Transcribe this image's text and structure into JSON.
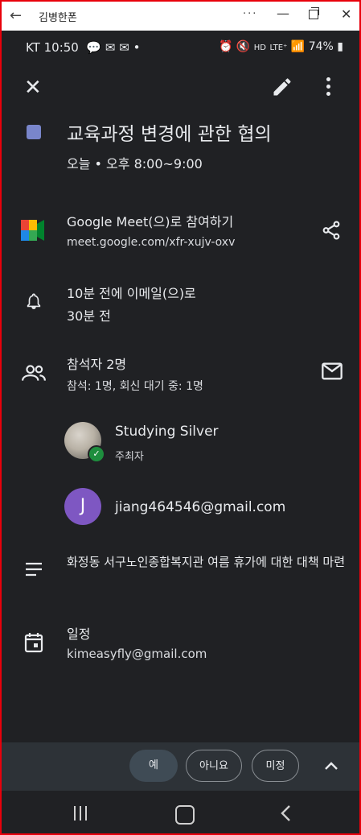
{
  "window": {
    "title": "김병한폰",
    "more": "···"
  },
  "status": {
    "carrier_time": "KT 10:50",
    "battery": "74%",
    "lte": "LTE⁺"
  },
  "event": {
    "title": "교육과정 변경에 관한 협의",
    "datetime": "오늘  •  오후 8:00~9:00",
    "color": "#7986cb"
  },
  "meet": {
    "join_label": "Google Meet(으)로 참여하기",
    "link": "meet.google.com/xfr-xujv-oxv"
  },
  "reminder": {
    "line1": "10분 전에 이메일(으)로",
    "line2": "30분 전"
  },
  "guests": {
    "summary": "참석자 2명",
    "detail": "참석: 1명, 회신 대기 중: 1명",
    "list": [
      {
        "name": "Studying Silver",
        "role": "주최자"
      },
      {
        "name": "jiang464546@gmail.com",
        "initial": "J"
      }
    ]
  },
  "description": "화정동 서구노인종합복지관 여름 휴가에 대한 대책 마련",
  "calendar": {
    "label": "일정",
    "account": "kimeasyfly@gmail.com"
  },
  "rsvp": {
    "yes": "예",
    "no": "아니요",
    "maybe": "미정"
  }
}
